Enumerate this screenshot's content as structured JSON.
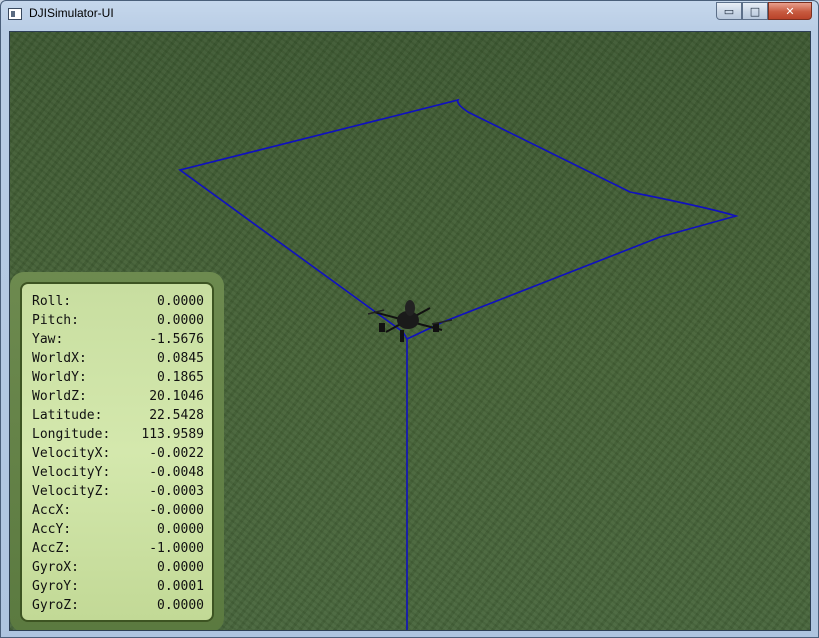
{
  "window": {
    "title": "DJISimulator-UI"
  },
  "controls": {
    "minimize": "▭",
    "maximize": "□",
    "close": "✕"
  },
  "telemetry": [
    {
      "label": "Roll:",
      "value": "0.0000"
    },
    {
      "label": "Pitch:",
      "value": "0.0000"
    },
    {
      "label": "Yaw:",
      "value": "-1.5676"
    },
    {
      "label": "WorldX:",
      "value": "0.0845"
    },
    {
      "label": "WorldY:",
      "value": "0.1865"
    },
    {
      "label": "WorldZ:",
      "value": "20.1046"
    },
    {
      "label": "Latitude:",
      "value": "22.5428"
    },
    {
      "label": "Longitude:",
      "value": "113.9589"
    },
    {
      "label": "VelocityX:",
      "value": "-0.0022"
    },
    {
      "label": "VelocityY:",
      "value": "-0.0048"
    },
    {
      "label": "VelocityZ:",
      "value": "-0.0003"
    },
    {
      "label": "AccX:",
      "value": "-0.0000"
    },
    {
      "label": "AccY:",
      "value": "0.0000"
    },
    {
      "label": "AccZ:",
      "value": "-1.0000"
    },
    {
      "label": "GyroX:",
      "value": "0.0000"
    },
    {
      "label": "GyroY:",
      "value": "0.0001"
    },
    {
      "label": "GyroZ:",
      "value": "0.0000"
    }
  ],
  "colors": {
    "flight_path": "#1010c0",
    "ground": "#456236",
    "panel": "#d4e8ad"
  }
}
